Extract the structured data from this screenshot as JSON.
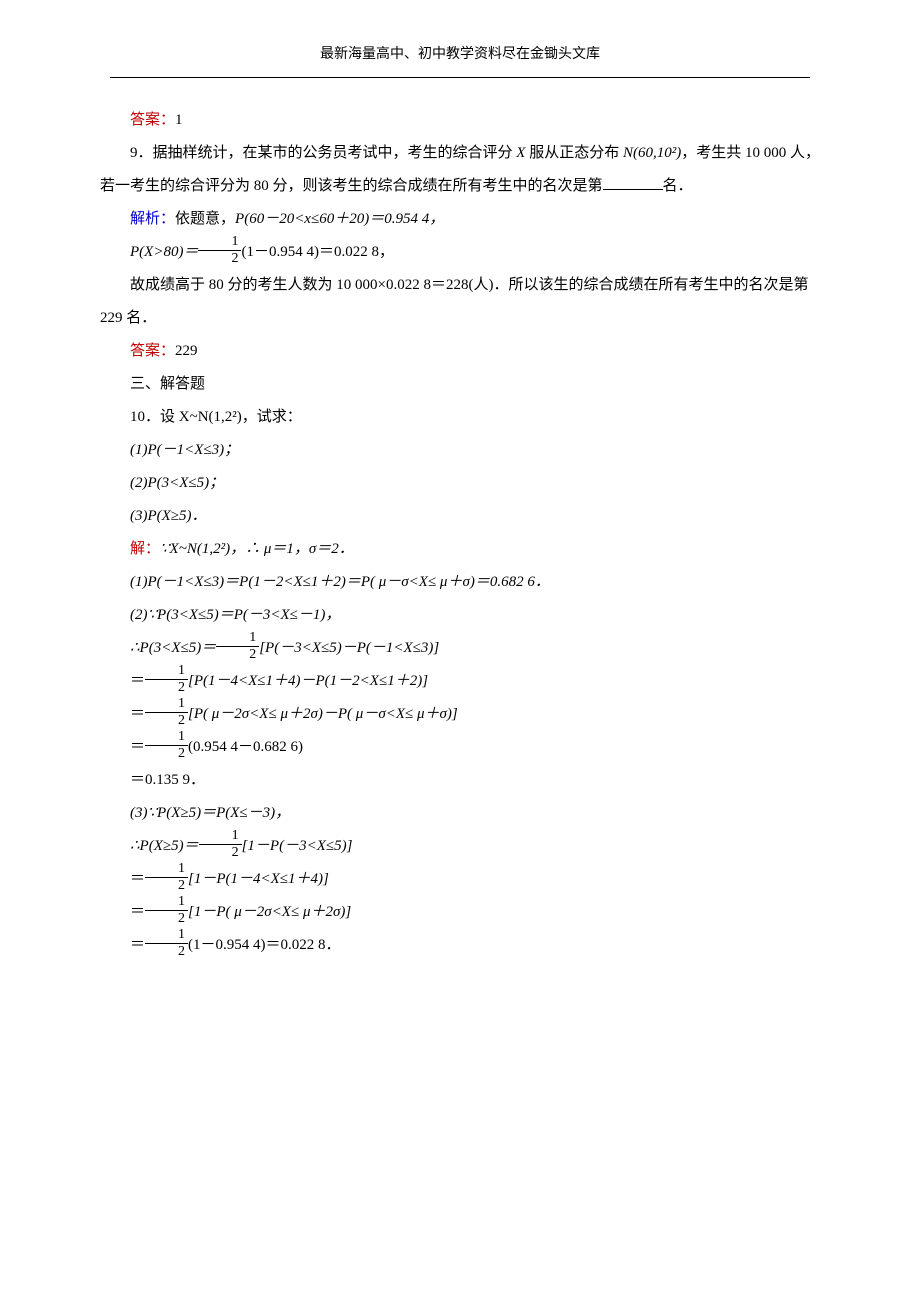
{
  "header": "最新海量高中、初中教学资料尽在金锄头文库",
  "ans8_label": "答案：",
  "ans8_value": "1",
  "q9": {
    "text1": "9．据抽样统计，在某市的公务员考试中，考生的综合评分 ",
    "text2": "服从正态分布 ",
    "dist": "N(60,10²)",
    "text3": "，考生共 10 000 人，若一考生的综合评分为 80 分，则该考生的综合成绩在所有考生中的名次是第",
    "text4": "名．",
    "parse_label": "解析：",
    "parse1": "依题意，",
    "parse_eq1": "P(60－20<x≤60＋20)＝0.954 4，",
    "parse_eq2a": "P(X>80)＝",
    "parse_eq2b": "(1－0.954 4)＝0.022 8，",
    "parse2": "故成绩高于 80 分的考生人数为 10 000×0.022 8＝228(人)．所以该生的综合成绩在所有考生中的名次是第 229 名．",
    "ans_label": "答案：",
    "ans_value": "229"
  },
  "section3": "三、解答题",
  "q10": {
    "stem": "10．设 X~N(1,2²)，试求：",
    "p1": "(1)P(－1<X≤3)；",
    "p2": "(2)P(3<X≤5)；",
    "p3": "(3)P(X≥5)．",
    "solve_label": "解：",
    "l0": "∵X~N(1,2²)，∴ μ＝1，σ＝2．",
    "l1": "(1)P(－1<X≤3)＝P(1－2<X≤1＋2)＝P( μ－σ<X≤ μ＋σ)＝0.682 6．",
    "l2": "(2)∵P(3<X≤5)＝P(－3<X≤－1)，",
    "l3a": "∴P(3<X≤5)＝",
    "l3b": "[P(－3<X≤5)－P(－1<X≤3)]",
    "l4a": "＝",
    "l4b": "[P(1－4<X≤1＋4)－P(1－2<X≤1＋2)]",
    "l5a": "＝",
    "l5b": "[P( μ－2σ<X≤ μ＋2σ)－P( μ－σ<X≤ μ＋σ)]",
    "l6a": "＝",
    "l6b": "(0.954 4－0.682 6)",
    "l7": "＝0.135 9．",
    "l8": "(3)∵P(X≥5)＝P(X≤－3)，",
    "l9a": "∴P(X≥5)＝",
    "l9b": "[1－P(－3<X≤5)]",
    "l10a": "＝",
    "l10b": "[1－P(1－4<X≤1＋4)]",
    "l11a": "＝",
    "l11b": "[1－P( μ－2σ<X≤ μ＋2σ)]",
    "l12a": "＝",
    "l12b": "(1－0.954 4)＝0.022 8．"
  },
  "half": {
    "num": "1",
    "den": "2"
  }
}
